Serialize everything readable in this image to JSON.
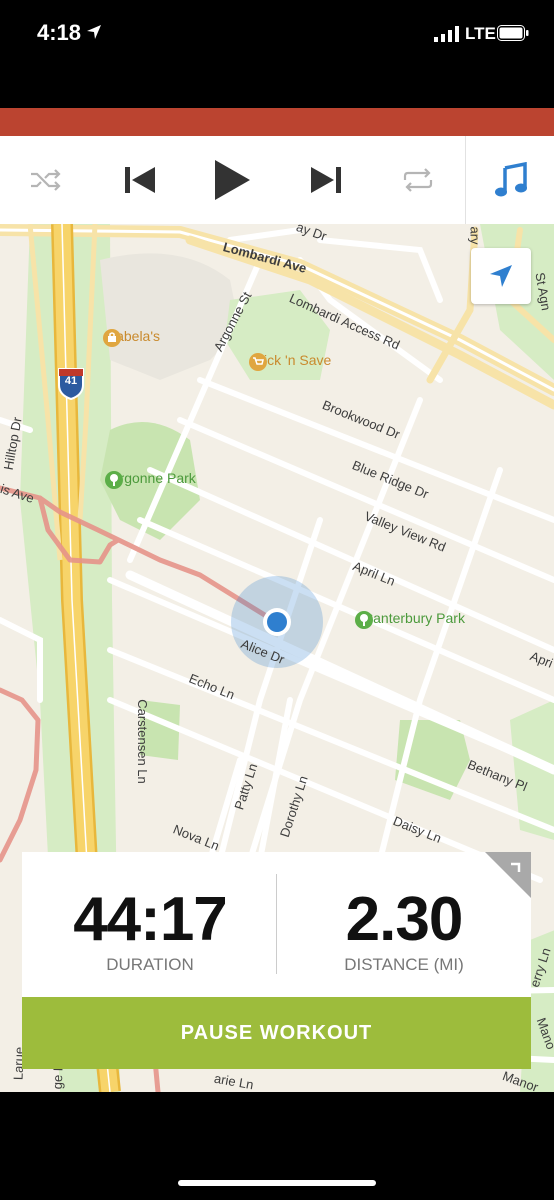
{
  "status_bar": {
    "time": "4:18",
    "network": "LTE"
  },
  "media_controls": {
    "icons": [
      "shuffle-icon",
      "previous-track-icon",
      "play-icon",
      "next-track-icon",
      "repeat-icon",
      "music-note-icon"
    ]
  },
  "map": {
    "streets": [
      "Lombardi Ave",
      "Lombardi Access Rd",
      "Argonne St",
      "Brookwood Dr",
      "Blue Ridge Dr",
      "Valley View Rd",
      "April Ln",
      "Alice Dr",
      "Echo Ln",
      "Carstensen Ln",
      "Patty Ln",
      "Dorothy Ln",
      "Nova Ln",
      "Daisy Ln",
      "Bethany Pl",
      "Hilltop Dr",
      "is Ave",
      "ay Dr",
      "ary",
      "St Agn",
      "Apri",
      "erry Ln",
      "Mano",
      "Manor",
      "arie Ln",
      "Larue",
      "ge D"
    ],
    "highway_shield": "41",
    "pois": {
      "cabelas": "Cabela's",
      "pick_n_save": "Pick 'n Save",
      "argonne_park": "Argonne Park",
      "canterbury_park": "Canterbury Park"
    },
    "colors": {
      "background": "#f3efe6",
      "park": "#d6ecc4",
      "highway": "#f2c94c",
      "route": "#e6948a",
      "location": "#2f7fcf"
    }
  },
  "stats": {
    "duration_value": "44:17",
    "duration_label": "DURATION",
    "distance_value": "2.30",
    "distance_label": "DISTANCE (MI)"
  },
  "actions": {
    "pause_label": "PAUSE WORKOUT"
  }
}
